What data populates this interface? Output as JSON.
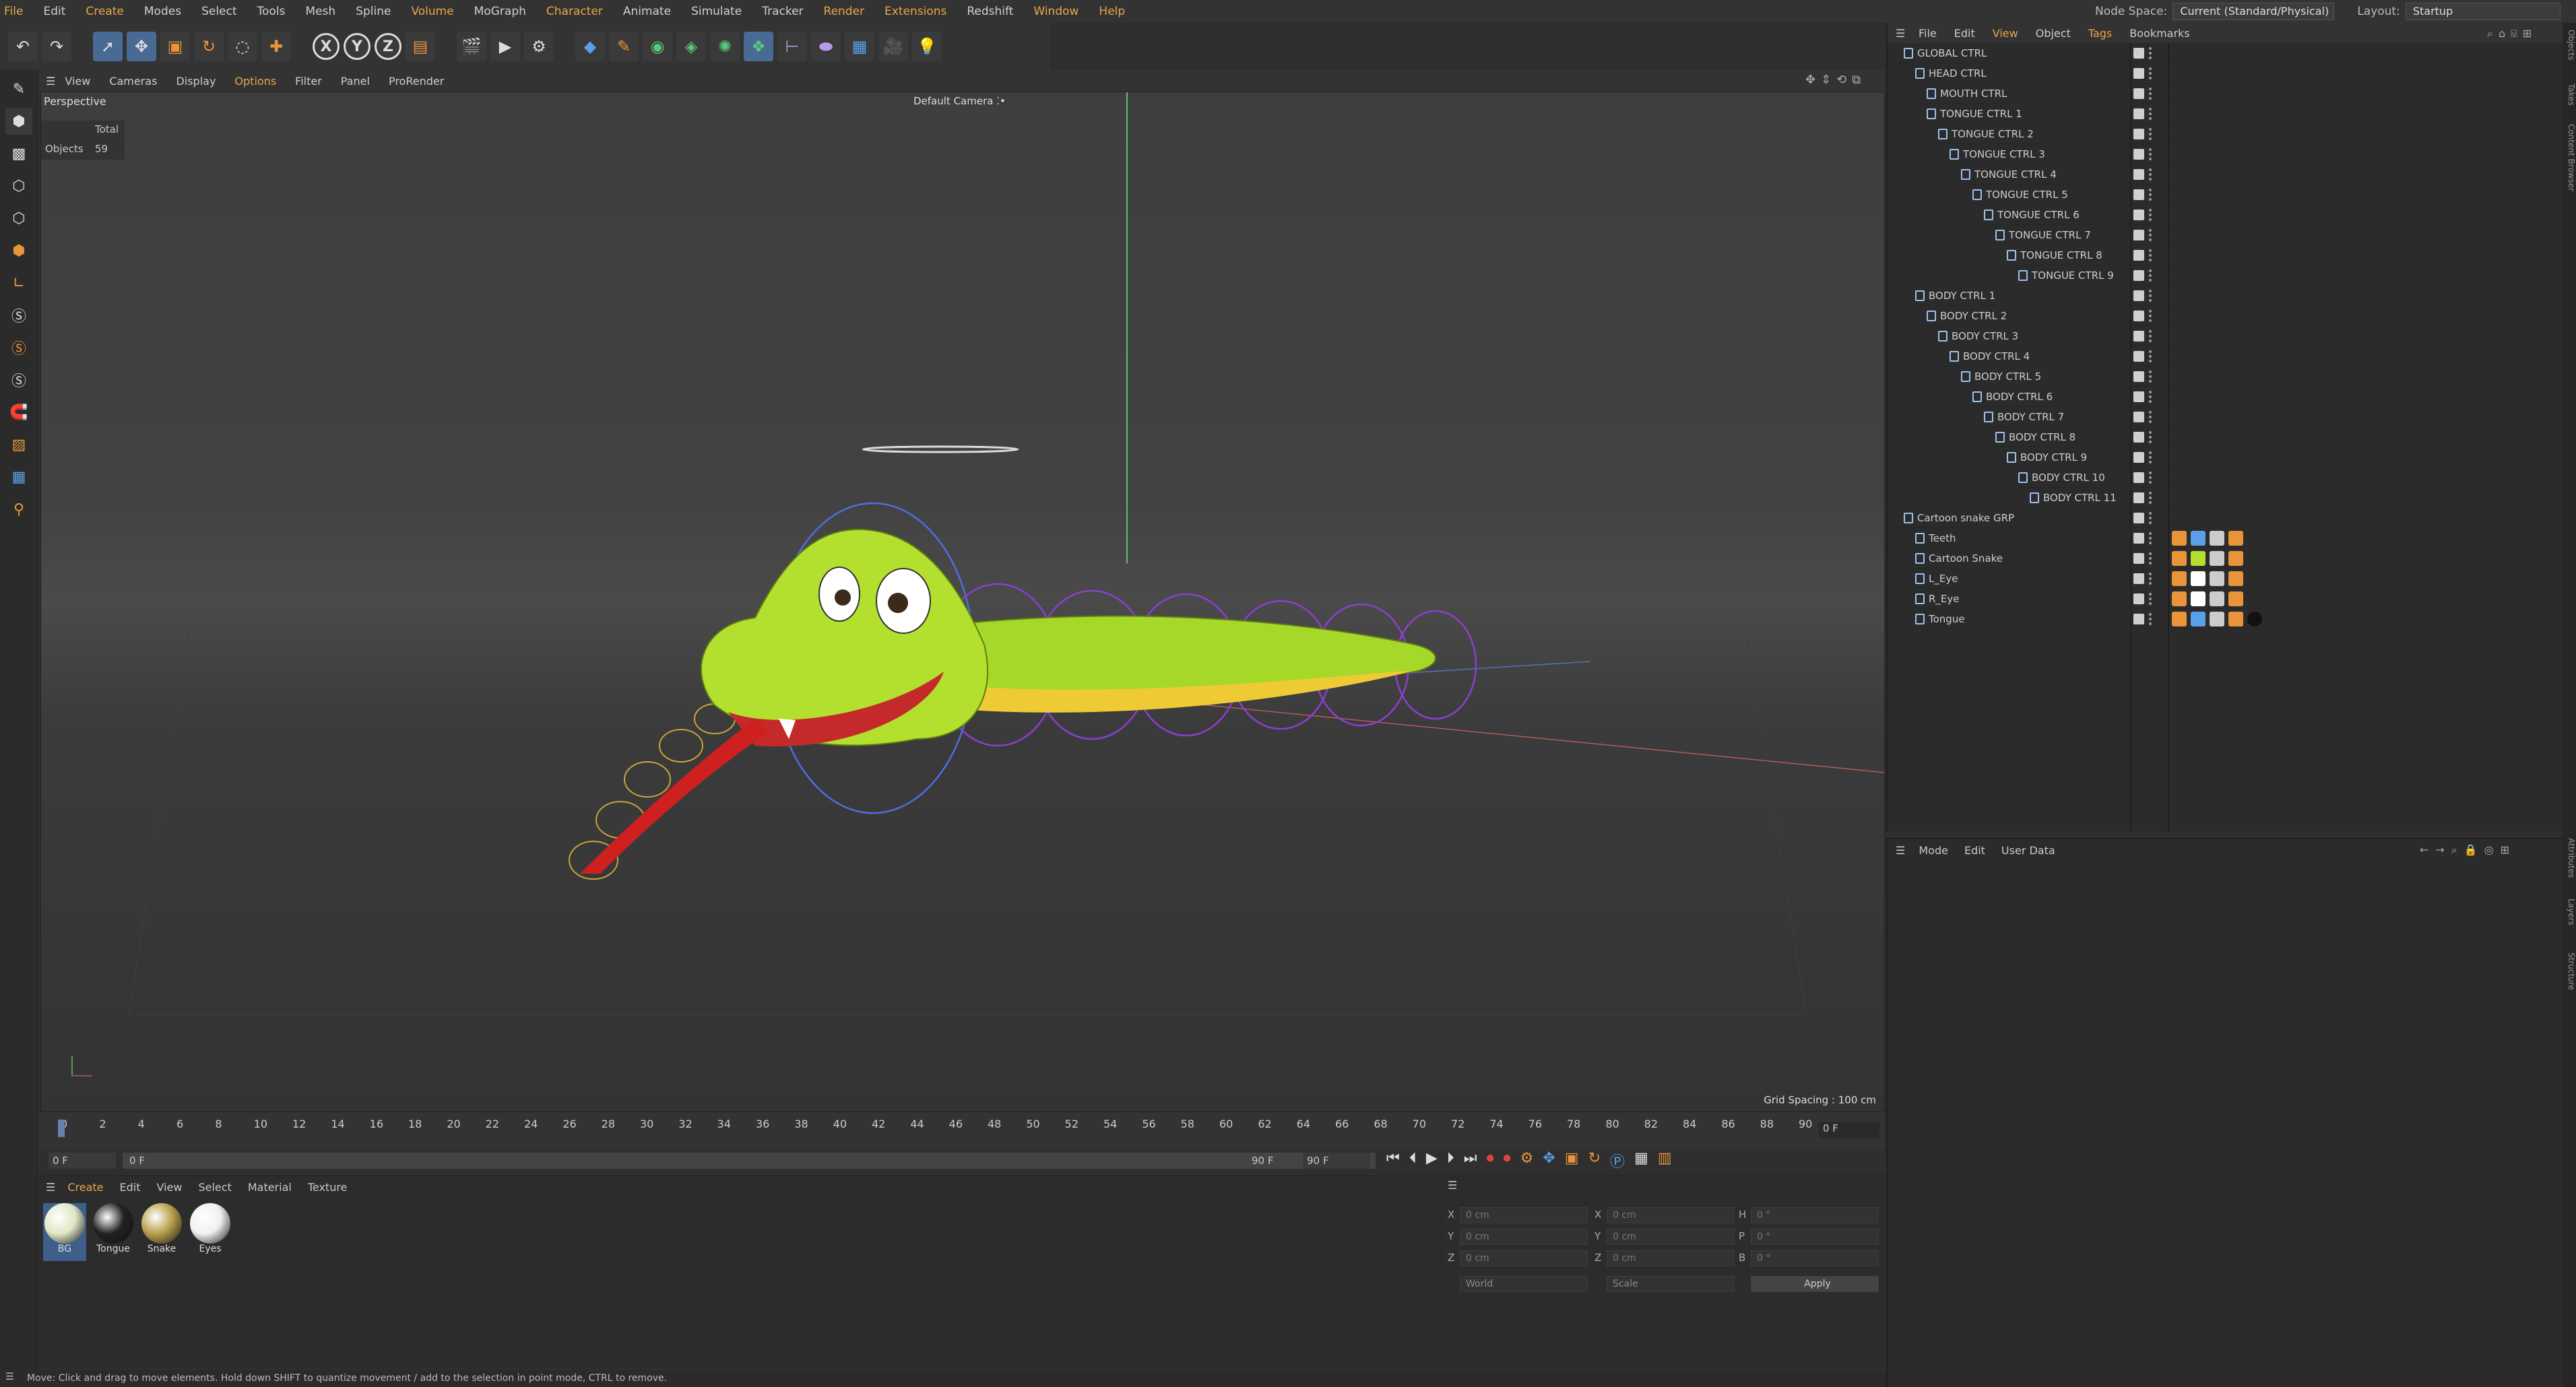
{
  "menu": [
    "File",
    "Edit",
    "Create",
    "Modes",
    "Select",
    "Tools",
    "Mesh",
    "Spline",
    "Volume",
    "MoGraph",
    "Character",
    "Animate",
    "Simulate",
    "Tracker",
    "Render",
    "Extensions",
    "Redshift",
    "Window",
    "Help"
  ],
  "topright": {
    "node_space_label": "Node Space:",
    "node_space_value": "Current (Standard/Physical)",
    "layout_label": "Layout:",
    "layout_value": "Startup"
  },
  "toolbar": {
    "axis_x": "X",
    "axis_y": "Y",
    "axis_z": "Z"
  },
  "viewport": {
    "menu": [
      "View",
      "Cameras",
      "Display",
      "Options",
      "Filter",
      "Panel",
      "ProRender"
    ],
    "name": "Perspective",
    "camera": "Default Camera",
    "stats_header": "Total",
    "stats_label": "Objects",
    "stats_value": "59",
    "grid_spacing": "Grid Spacing : 100 cm"
  },
  "timeline": {
    "ticks": [
      "0",
      "2",
      "4",
      "6",
      "8",
      "10",
      "12",
      "14",
      "16",
      "18",
      "20",
      "22",
      "24",
      "26",
      "28",
      "30",
      "32",
      "34",
      "36",
      "38",
      "40",
      "42",
      "44",
      "46",
      "48",
      "50",
      "52",
      "54",
      "56",
      "58",
      "60",
      "62",
      "64",
      "66",
      "68",
      "70",
      "72",
      "74",
      "76",
      "78",
      "80",
      "82",
      "84",
      "86",
      "88",
      "90"
    ],
    "current_frame": "0 F",
    "start": "0 F",
    "min": "0 F",
    "end": "90 F",
    "max": "90 F"
  },
  "materials": {
    "menu": [
      "Create",
      "Edit",
      "View",
      "Select",
      "Material",
      "Texture"
    ],
    "items": [
      {
        "name": "BG",
        "color": "#dfe7c6"
      },
      {
        "name": "Tongue",
        "color": "#222"
      },
      {
        "name": "Snake",
        "color": "#b7a14a"
      },
      {
        "name": "Eyes",
        "color": "#f0f0f0"
      }
    ]
  },
  "coords": {
    "x": "X",
    "y": "Y",
    "z": "Z",
    "p_x": "0 cm",
    "p_y": "0 cm",
    "p_z": "0 cm",
    "s_x": "0 cm",
    "s_y": "0 cm",
    "s_z": "0 cm",
    "h": "H",
    "p": "P",
    "b": "B",
    "r_h": "0 °",
    "r_p": "0 °",
    "r_b": "0 °",
    "world": "World",
    "scale": "Scale",
    "apply": "Apply"
  },
  "object_manager": {
    "menu": [
      "File",
      "Edit",
      "View",
      "Object",
      "Tags",
      "Bookmarks"
    ],
    "rows": [
      {
        "name": "GLOBAL CTRL",
        "indent": 0
      },
      {
        "name": "HEAD CTRL",
        "indent": 1
      },
      {
        "name": "MOUTH CTRL",
        "indent": 2
      },
      {
        "name": "TONGUE CTRL 1",
        "indent": 2
      },
      {
        "name": "TONGUE CTRL 2",
        "indent": 3
      },
      {
        "name": "TONGUE CTRL 3",
        "indent": 4
      },
      {
        "name": "TONGUE CTRL 4",
        "indent": 5
      },
      {
        "name": "TONGUE CTRL 5",
        "indent": 6
      },
      {
        "name": "TONGUE CTRL 6",
        "indent": 7
      },
      {
        "name": "TONGUE CTRL 7",
        "indent": 8
      },
      {
        "name": "TONGUE CTRL 8",
        "indent": 9
      },
      {
        "name": "TONGUE CTRL 9",
        "indent": 10
      },
      {
        "name": "BODY CTRL 1",
        "indent": 1
      },
      {
        "name": "BODY CTRL 2",
        "indent": 2
      },
      {
        "name": "BODY CTRL 3",
        "indent": 3
      },
      {
        "name": "BODY CTRL 4",
        "indent": 4
      },
      {
        "name": "BODY CTRL 5",
        "indent": 5
      },
      {
        "name": "BODY CTRL 6",
        "indent": 6
      },
      {
        "name": "BODY CTRL 7",
        "indent": 7
      },
      {
        "name": "BODY CTRL 8",
        "indent": 8
      },
      {
        "name": "BODY CTRL 9",
        "indent": 9
      },
      {
        "name": "BODY CTRL 10",
        "indent": 10
      },
      {
        "name": "BODY CTRL 11",
        "indent": 11
      },
      {
        "name": "Cartoon snake GRP",
        "indent": 0
      },
      {
        "name": "Teeth",
        "indent": 1
      },
      {
        "name": "Cartoon Snake",
        "indent": 1
      },
      {
        "name": "L_Eye",
        "indent": 1
      },
      {
        "name": "R_Eye",
        "indent": 1
      },
      {
        "name": "Tongue",
        "indent": 1
      }
    ]
  },
  "attributes": {
    "menu": [
      "Mode",
      "Edit",
      "User Data"
    ]
  },
  "side_tabs": [
    "Objects",
    "Takes",
    "Content Browser",
    "Attributes",
    "Layers",
    "Structure"
  ],
  "status": "Move: Click and drag to move elements. Hold down SHIFT to quantize movement / add to the selection in point mode, CTRL to remove."
}
